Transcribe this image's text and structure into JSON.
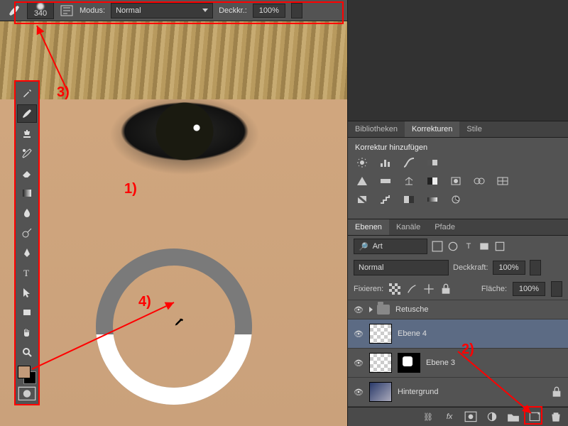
{
  "optionsBar": {
    "brush_size": "340",
    "mode_label": "Modus:",
    "mode_value": "Normal",
    "opacity_label": "Deckkr.:",
    "opacity_value": "100%"
  },
  "toolbar": {
    "tools": [
      "healing-brush",
      "brush",
      "clone-stamp",
      "history-brush",
      "eraser",
      "gradient",
      "blur",
      "dodge",
      "pen",
      "type",
      "path-select",
      "rectangle",
      "hand",
      "zoom"
    ],
    "foreground_color": "#c29a7a",
    "background_color": "#000000"
  },
  "panels": {
    "top_tabs": [
      "Bibliotheken",
      "Korrekturen",
      "Stile"
    ],
    "top_active": "Korrekturen",
    "adjustments_title": "Korrektur hinzufügen",
    "layers_tabs": [
      "Ebenen",
      "Kanäle",
      "Pfade"
    ],
    "layers_active": "Ebenen",
    "filter_kind": "Art",
    "blend_mode": "Normal",
    "opacity_label": "Deckkraft:",
    "opacity_value": "100%",
    "lock_label": "Fixieren:",
    "fill_label": "Fläche:",
    "fill_value": "100%",
    "layers": [
      {
        "type": "group",
        "name": "Retusche"
      },
      {
        "type": "layer",
        "name": "Ebene 4",
        "thumb": "checker",
        "active": true
      },
      {
        "type": "layer",
        "name": "Ebene 3",
        "thumb": "checker",
        "mask": true
      },
      {
        "type": "layer",
        "name": "Hintergrund",
        "thumb": "photo"
      }
    ]
  },
  "annotations": {
    "n1": "1)",
    "n2": "2)",
    "n3": "3)",
    "n4": "4)"
  }
}
